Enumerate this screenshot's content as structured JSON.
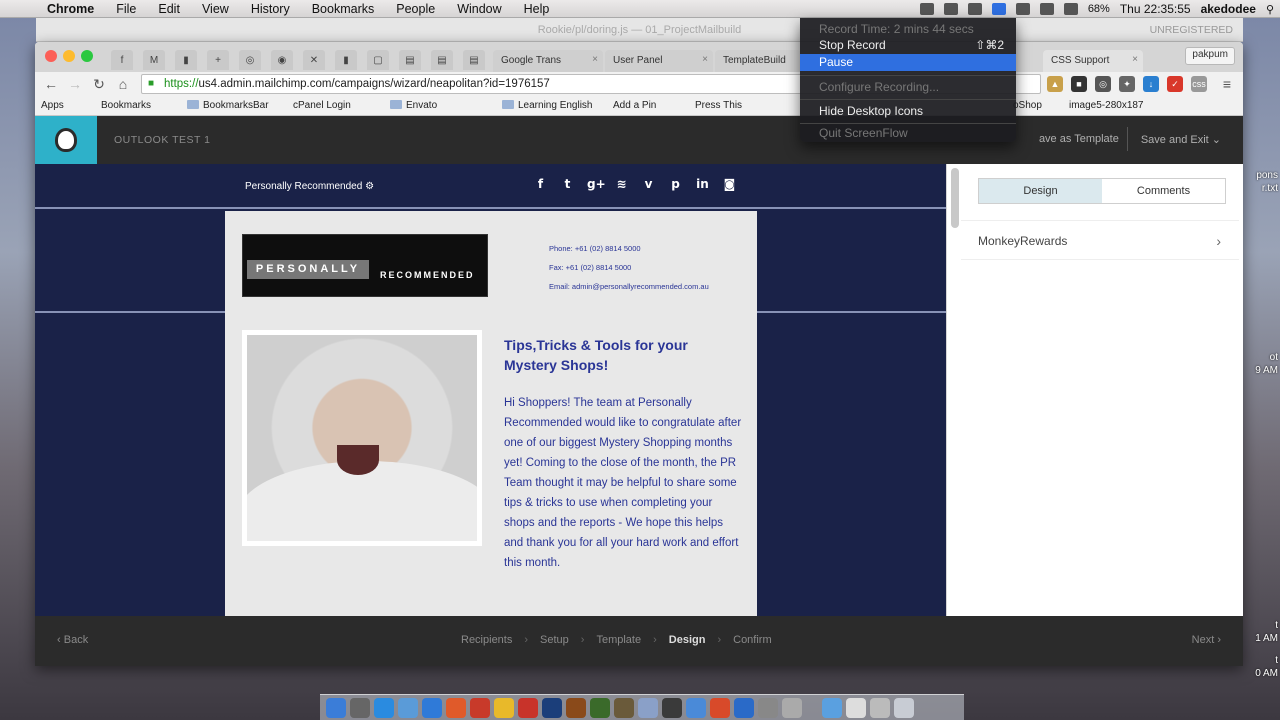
{
  "menubar": {
    "app": "Chrome",
    "items": [
      "File",
      "Edit",
      "View",
      "History",
      "Bookmarks",
      "People",
      "Window",
      "Help"
    ],
    "battery": "68%",
    "clock": "Thu 22:35:55",
    "user": "akedodee"
  },
  "desktop_slivers": [
    "pons",
    "r.txt",
    "ot",
    "9 AM",
    "t",
    "1 AM",
    "t",
    "0 AM"
  ],
  "background_window": {
    "title": "Rookie/pl/doring.js — 01_ProjectMailbuild",
    "unregistered": "UNREGISTERED"
  },
  "chrome": {
    "tabs": [
      {
        "label": "Google Trans"
      },
      {
        "label": "User Panel"
      },
      {
        "label": "TemplateBuild"
      },
      {
        "label": "CSS Support"
      }
    ],
    "profile": "pakpum",
    "url_scheme": "https://",
    "url_rest": "us4.admin.mailchimp.com/campaigns/wizard/neapolitan?id=1976157",
    "bookmarks": [
      "Apps",
      "Bookmarks",
      "BookmarksBar",
      "cPanel Login",
      "Envato",
      "Learning English",
      "Add a Pin",
      "Press This",
      "oShop",
      "image5-280x187"
    ]
  },
  "mailchimp": {
    "campaign_name": "OUTLOOK TEST 1",
    "save_template": "ave as Template",
    "save_exit": "Save and Exit",
    "email": {
      "preheader": "Personally Recommended",
      "logo_word1": "PERSONALLY",
      "logo_word2": "RECOMMENDED",
      "phone": "Phone: +61 (02) 8814 5000",
      "fax": "Fax: +61 (02) 8814 5000",
      "email": "Email: admin@personallyrecommended.com.au",
      "post_title": "Tips,Tricks & Tools for your Mystery Shops!",
      "post_body": "Hi Shoppers! The team at Personally Recommended would like to congratulate after one of our biggest Mystery Shopping months yet! Coming to the close of the month, the PR Team thought it may be helpful to share some tips & tricks to use when completing your shops and the reports - We hope this helps and thank you for all your hard work and effort this month."
    },
    "panel": {
      "tab_design": "Design",
      "tab_comments": "Comments",
      "row": "MonkeyRewards"
    },
    "wizard": {
      "back": "Back",
      "next": "Next",
      "steps": [
        "Recipients",
        "Setup",
        "Template",
        "Design",
        "Confirm"
      ],
      "current_step": "Design"
    }
  },
  "screenflow_menu": {
    "record_time": "Record Time: 2 mins 44 secs",
    "stop_record": "Stop Record",
    "stop_shortcut": "⇧⌘2",
    "pause": "Pause",
    "configure": "Configure Recording...",
    "hide_icons": "Hide Desktop Icons",
    "quit": "Quit ScreenFlow"
  },
  "colors": {
    "mailchimp_teal": "#2eb1c9",
    "email_navy": "#1a2248",
    "email_text": "#2a3596",
    "menu_highlight": "#2f6fe0"
  }
}
